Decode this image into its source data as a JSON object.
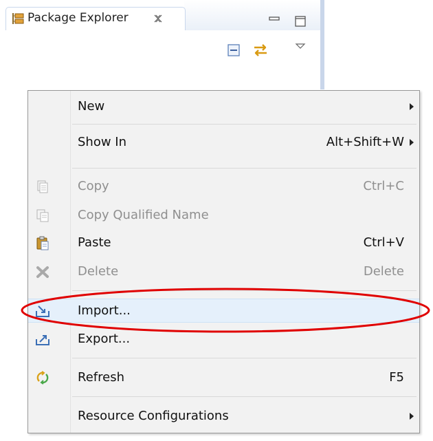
{
  "view": {
    "title": "Package Explorer",
    "icons": {
      "view_icon": "package-explorer-icon",
      "close": "close-tab-icon",
      "minimize": "minimize-icon",
      "maximize": "maximize-icon",
      "collapse_all": "collapse-all-icon",
      "link_with_editor": "link-with-editor-icon",
      "view_menu": "view-menu-icon"
    }
  },
  "menu": {
    "items": [
      {
        "label": "New",
        "accel": "",
        "submenu": true,
        "enabled": true,
        "icon": ""
      },
      {
        "label": "Show In",
        "accel": "Alt+Shift+W",
        "submenu": true,
        "enabled": true,
        "icon": ""
      },
      {
        "label": "Copy",
        "accel": "Ctrl+C",
        "submenu": false,
        "enabled": false,
        "icon": "copy-icon"
      },
      {
        "label": "Copy Qualified Name",
        "accel": "",
        "submenu": false,
        "enabled": false,
        "icon": "copy-qualified-name-icon"
      },
      {
        "label": "Paste",
        "accel": "Ctrl+V",
        "submenu": false,
        "enabled": true,
        "icon": "paste-icon"
      },
      {
        "label": "Delete",
        "accel": "Delete",
        "submenu": false,
        "enabled": false,
        "icon": "delete-icon"
      },
      {
        "label": "Import...",
        "accel": "",
        "submenu": false,
        "enabled": true,
        "icon": "import-icon",
        "selected": true
      },
      {
        "label": "Export...",
        "accel": "",
        "submenu": false,
        "enabled": true,
        "icon": "export-icon"
      },
      {
        "label": "Refresh",
        "accel": "F5",
        "submenu": false,
        "enabled": true,
        "icon": "refresh-icon"
      },
      {
        "label": "Resource Configurations",
        "accel": "",
        "submenu": true,
        "enabled": true,
        "icon": ""
      }
    ]
  },
  "annotation": {
    "highlight_color": "#e00000",
    "highlight_target": "Import..."
  }
}
